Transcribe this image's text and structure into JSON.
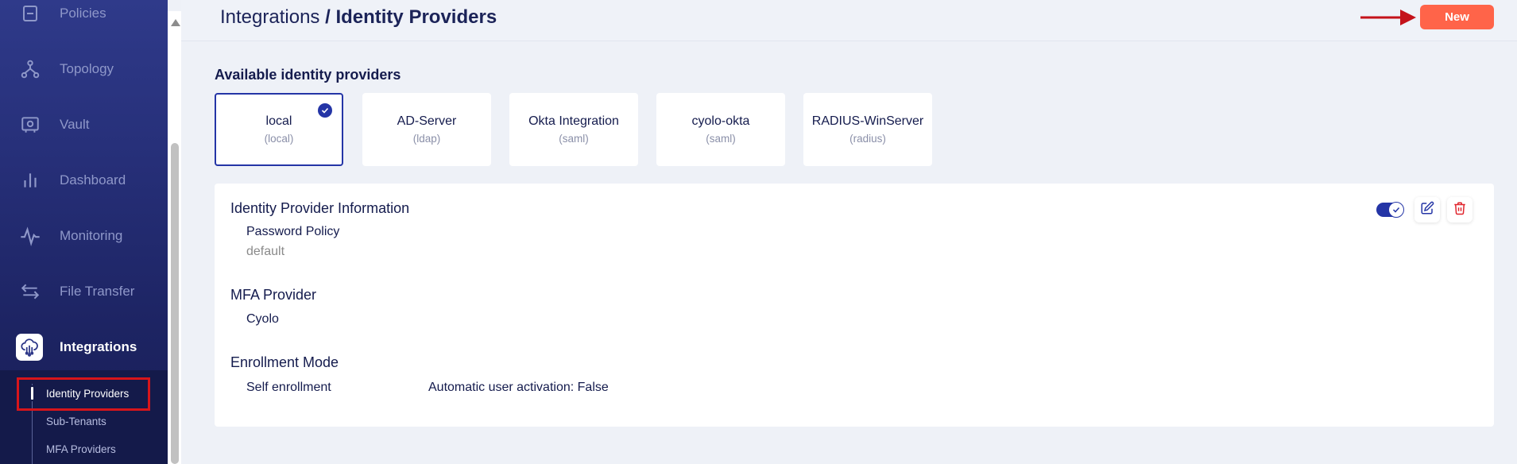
{
  "sidebar": {
    "items": [
      {
        "label": "Policies",
        "icon": "policies-icon"
      },
      {
        "label": "Topology",
        "icon": "topology-icon"
      },
      {
        "label": "Vault",
        "icon": "vault-icon"
      },
      {
        "label": "Dashboard",
        "icon": "dashboard-icon"
      },
      {
        "label": "Monitoring",
        "icon": "monitoring-icon"
      },
      {
        "label": "File Transfer",
        "icon": "file-transfer-icon"
      },
      {
        "label": "Integrations",
        "icon": "integrations-icon"
      }
    ],
    "sub_items": [
      {
        "label": "Identity Providers"
      },
      {
        "label": "Sub-Tenants"
      },
      {
        "label": "MFA Providers"
      }
    ]
  },
  "header": {
    "breadcrumb_parent": "Integrations",
    "breadcrumb_separator": " / ",
    "breadcrumb_current": "Identity Providers",
    "new_button": "New"
  },
  "providers": {
    "title": "Available identity providers",
    "items": [
      {
        "name": "local",
        "type": "(local)"
      },
      {
        "name": "AD-Server",
        "type": "(ldap)"
      },
      {
        "name": "Okta Integration",
        "type": "(saml)"
      },
      {
        "name": "cyolo-okta",
        "type": "(saml)"
      },
      {
        "name": "RADIUS-WinServer",
        "type": "(radius)"
      }
    ]
  },
  "details": {
    "info_title": "Identity Provider Information",
    "password_policy_label": "Password Policy",
    "password_policy_value": "default",
    "mfa_title": "MFA Provider",
    "mfa_value": "Cyolo",
    "enrollment_title": "Enrollment Mode",
    "enrollment_value": "Self enrollment",
    "auto_activation": "Automatic user activation: False"
  },
  "colors": {
    "accent": "#2435a6",
    "new_button": "#ff6449",
    "annotation": "#d7151b"
  }
}
